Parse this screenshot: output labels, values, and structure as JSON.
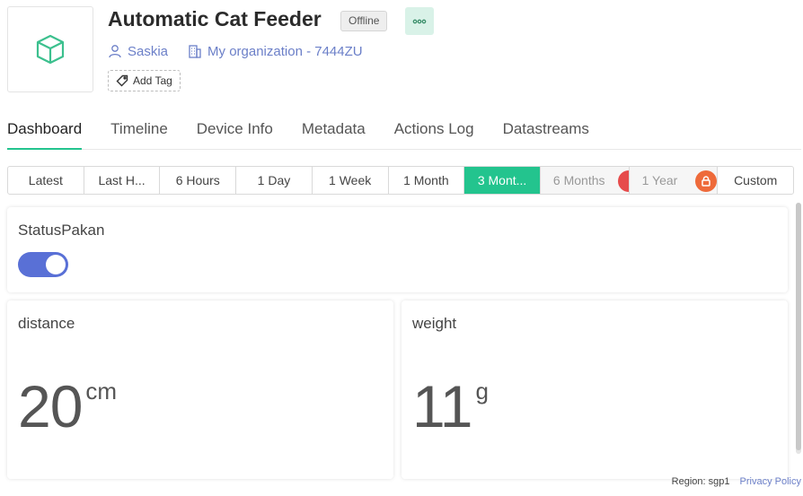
{
  "device": {
    "title": "Automatic Cat Feeder",
    "status": "Offline",
    "owner": "Saskia",
    "organization": "My organization - 7444ZU",
    "add_tag_label": "Add Tag"
  },
  "tabs": [
    {
      "label": "Dashboard",
      "active": true
    },
    {
      "label": "Timeline"
    },
    {
      "label": "Device Info"
    },
    {
      "label": "Metadata"
    },
    {
      "label": "Actions Log"
    },
    {
      "label": "Datastreams"
    }
  ],
  "time_ranges": [
    {
      "label": "Latest"
    },
    {
      "label": "Last H..."
    },
    {
      "label": "6 Hours"
    },
    {
      "label": "1 Day"
    },
    {
      "label": "1 Week"
    },
    {
      "label": "1 Month"
    },
    {
      "label": "3 Mont...",
      "active": true
    },
    {
      "label": "6 Months",
      "locked": true
    },
    {
      "label": "1 Year",
      "locked": true
    },
    {
      "label": "Custom"
    }
  ],
  "widgets": {
    "status": {
      "title": "StatusPakan",
      "on": true
    },
    "distance": {
      "title": "distance",
      "value": "20",
      "unit": "cm"
    },
    "weight": {
      "title": "weight",
      "value": "11",
      "unit": "g"
    }
  },
  "footer": {
    "region": "Region: sgp1",
    "privacy": "Privacy Policy"
  },
  "colors": {
    "accent": "#23c48e",
    "link": "#6b7fc8",
    "switch_on": "#5970d6",
    "lock": "#ee6a3a"
  },
  "icons": {
    "device": "cube-icon",
    "more": "more-dots-icon",
    "owner": "user-icon",
    "organization": "building-icon",
    "tag": "tag-icon",
    "lock": "lock-icon"
  }
}
